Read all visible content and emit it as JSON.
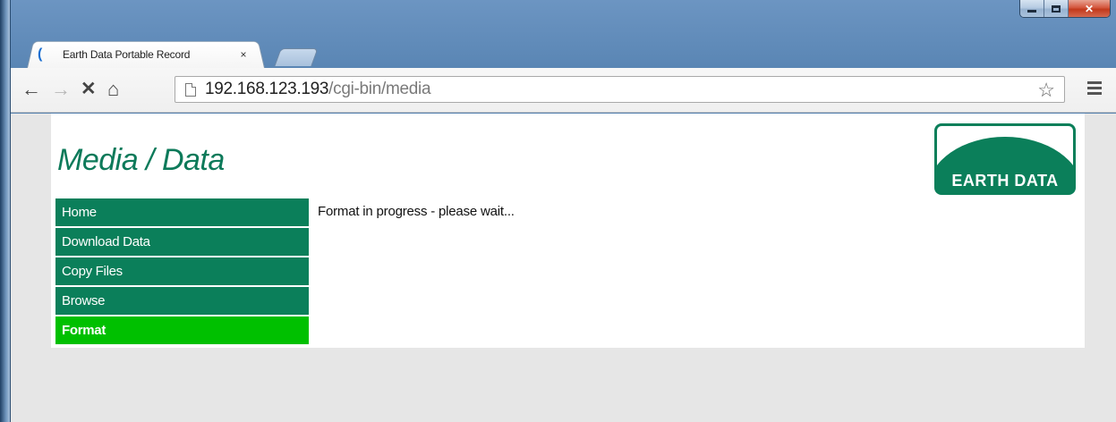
{
  "browser": {
    "tab_title": "Earth Data Portable Record",
    "tab_close": "×",
    "url_host": "192.168.123.193",
    "url_path": "/cgi-bin/media"
  },
  "icons": {
    "back": "arrow-left-icon",
    "forward": "arrow-right-icon",
    "stop": "close-icon",
    "home": "home-icon",
    "star": "star-icon",
    "menu": "hamburger-menu-icon"
  },
  "page": {
    "title": "Media / Data",
    "logo_text": "EARTH DATA",
    "status_message": "Format in progress - please wait...",
    "nav": [
      {
        "label": "Home",
        "active": false
      },
      {
        "label": "Download Data",
        "active": false
      },
      {
        "label": "Copy Files",
        "active": false
      },
      {
        "label": "Browse",
        "active": false
      },
      {
        "label": "Format",
        "active": true
      }
    ]
  },
  "colors": {
    "brand_green": "#0b7f5a",
    "active_green": "#00c000",
    "title_green": "#0d7a5a"
  }
}
